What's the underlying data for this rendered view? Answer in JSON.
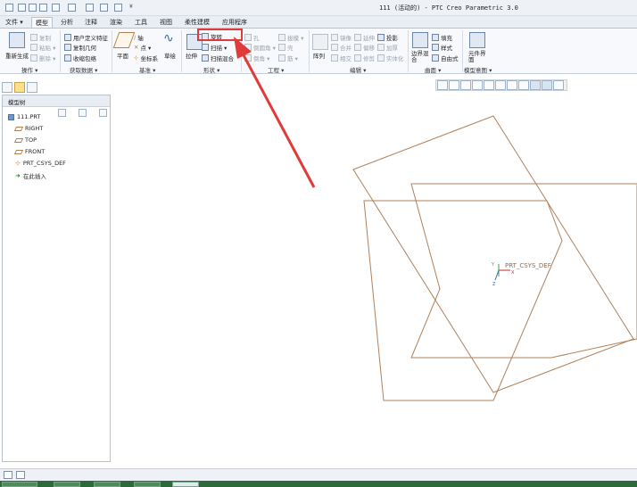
{
  "title_bar": {
    "app_title": "111 (活动的) - PTC Creo Parametric 3.0",
    "quick_access_icons": [
      "new-file-icon",
      "open-icon",
      "save-icon",
      "undo-icon",
      "redo-icon",
      "regenerate-icon",
      "window-icon",
      "close-window-icon"
    ],
    "customize_symbol": "¥"
  },
  "ribbon_tabs": [
    "文件 ▾",
    "模型",
    "分析",
    "注释",
    "渲染",
    "工具",
    "视图",
    "柔性建模",
    "应用程序"
  ],
  "active_tab": "模型",
  "ribbon": {
    "groups": [
      "操作 ▾",
      "获取数据 ▾",
      "基准 ▾",
      "形状 ▾",
      "工程 ▾",
      "编辑 ▾",
      "曲面 ▾",
      "模型意图 ▾"
    ],
    "operations": {
      "regenerate": "重新生成",
      "copy": "复制",
      "paste": "粘贴 ▾",
      "delete": "删除 ▾"
    },
    "get_data": {
      "user_defined_feature": "用户定义特征",
      "copy_geometry": "复制几何",
      "shrinkwrap": "收缩包络"
    },
    "datum": {
      "plane": "平面",
      "axis": "轴",
      "point": "点 ▾",
      "csys": "坐标系",
      "sketch": "草绘"
    },
    "shape": {
      "extrude": "拉伸",
      "revolve": "旋转",
      "sweep": "扫描 ▾",
      "swept_blend": "扫描混合"
    },
    "engineering": {
      "hole": "孔",
      "round": "倒圆角 ▾",
      "chamfer": "倒角 ▾",
      "draft": "拔模 ▾",
      "shell": "壳",
      "rib": "筋 ▾"
    },
    "editing": {
      "pattern": "阵列",
      "mirror": "镜像",
      "extend": "延伸",
      "project": "投影",
      "trim": "修剪",
      "offset": "偏移",
      "thicken": "加厚",
      "merge": "合并",
      "intersect": "相交",
      "solidify": "实体化"
    },
    "surfaces": {
      "boundary_blend": "边界混合",
      "fill": "填充",
      "style": "样式",
      "freestyle": "自由式"
    },
    "model_intent": {
      "component_interface": "元件界面"
    }
  },
  "model_tree": {
    "header": "模型树",
    "items": [
      "111.PRT",
      "RIGHT",
      "TOP",
      "FRONT",
      "PRT_CSYS_DEF",
      "在此插入"
    ]
  },
  "graphics": {
    "csys_label": "PRT_CSYS_DEF",
    "axis_x": "X",
    "axis_y": "Y",
    "axis_z": "Z",
    "datum_color": "#b0805a"
  },
  "colors": {
    "highlight_box": "#e03a3a",
    "annotation_arrow": "#e03a3a",
    "taskbar": "#2d6a3a"
  }
}
